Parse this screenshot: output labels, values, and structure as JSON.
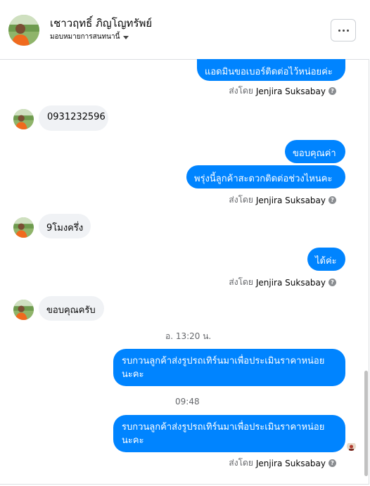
{
  "header": {
    "contact_name": "เชาวฤทธิ์ ภิญโญทรัพย์",
    "assign_label": "มอบหมายการสนทนานี้"
  },
  "messages": {
    "m1": "แอดมินขอเบอร์ติดต่อไว้หน่อยค่ะ",
    "m2": "0931232596",
    "m3": "ขอบคุณค่า",
    "m4": "พรุ่งนี้ลูกค้าสะดวกติดต่อช่วงไหนคะ",
    "m5": "9โมงครึ่ง",
    "m6": "ได้ค่ะ",
    "m7": "ขอบคุณครับ",
    "m8_line1": "รบกวนลูกค้าส่งรูปรถเทิร์นมาเพื่อประเมินราคาหน่อย",
    "m8_line2": "นะคะ",
    "m9_line1": "รบกวนลูกค้าส่งรูปรถเทิร์นมาเพื่อประเมินราคาหน่อย",
    "m9_line2": "นะคะ"
  },
  "sent_by": {
    "prefix": "ส่งโดย",
    "name": "Jenjira Suksabay"
  },
  "timestamps": {
    "t1": "อ. 13:20 น.",
    "t2": "09:48"
  },
  "colors": {
    "outgoing": "#0084ff",
    "incoming": "#f0f2f5"
  },
  "icons": {
    "more": "more-horizontal-icon",
    "info": "question-icon",
    "caret": "caret-down-icon"
  }
}
